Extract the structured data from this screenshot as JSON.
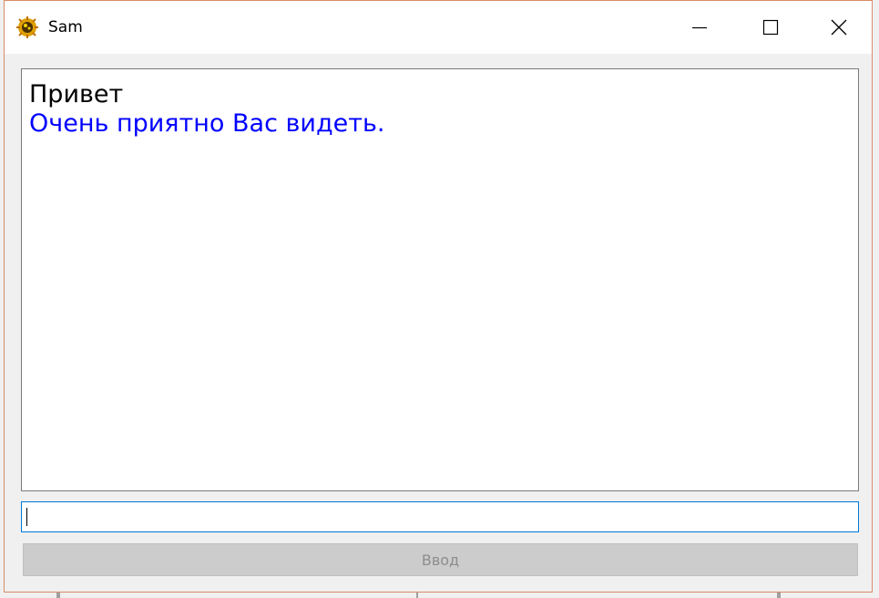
{
  "window": {
    "title": "Sam",
    "border_color": "#d98c6a"
  },
  "titlebar": {
    "icon": "bug-app-icon",
    "buttons": [
      "minimize-icon",
      "maximize-icon",
      "close-icon"
    ]
  },
  "chat": {
    "messages": [
      {
        "text": "Привет",
        "color": "#000000"
      },
      {
        "text": "Очень приятно Вас видеть.",
        "color": "#0000ff"
      }
    ]
  },
  "input": {
    "value": ""
  },
  "send_button": {
    "label": "Ввод",
    "state": "disabled"
  }
}
